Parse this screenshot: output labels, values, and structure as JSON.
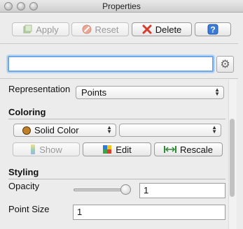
{
  "window": {
    "title": "Properties"
  },
  "toolbar": {
    "apply_label": "Apply",
    "reset_label": "Reset",
    "delete_label": "Delete",
    "help_label": "?"
  },
  "search": {
    "value": "",
    "placeholder": ""
  },
  "representation": {
    "label": "Representation",
    "selected": "Points"
  },
  "coloring": {
    "heading": "Coloring",
    "color_mode": "Solid Color",
    "secondary": "",
    "show_label": "Show",
    "edit_label": "Edit",
    "rescale_label": "Rescale",
    "solid_color": "#c0802a"
  },
  "styling": {
    "heading": "Styling",
    "opacity_label": "Opacity",
    "opacity_value": "1",
    "point_size_label": "Point Size",
    "point_size_value": "1"
  },
  "colors": {
    "delete_icon": "#d63a2a",
    "help_icon": "#2b6fd6",
    "focus_ring": "#6fa8e6"
  }
}
